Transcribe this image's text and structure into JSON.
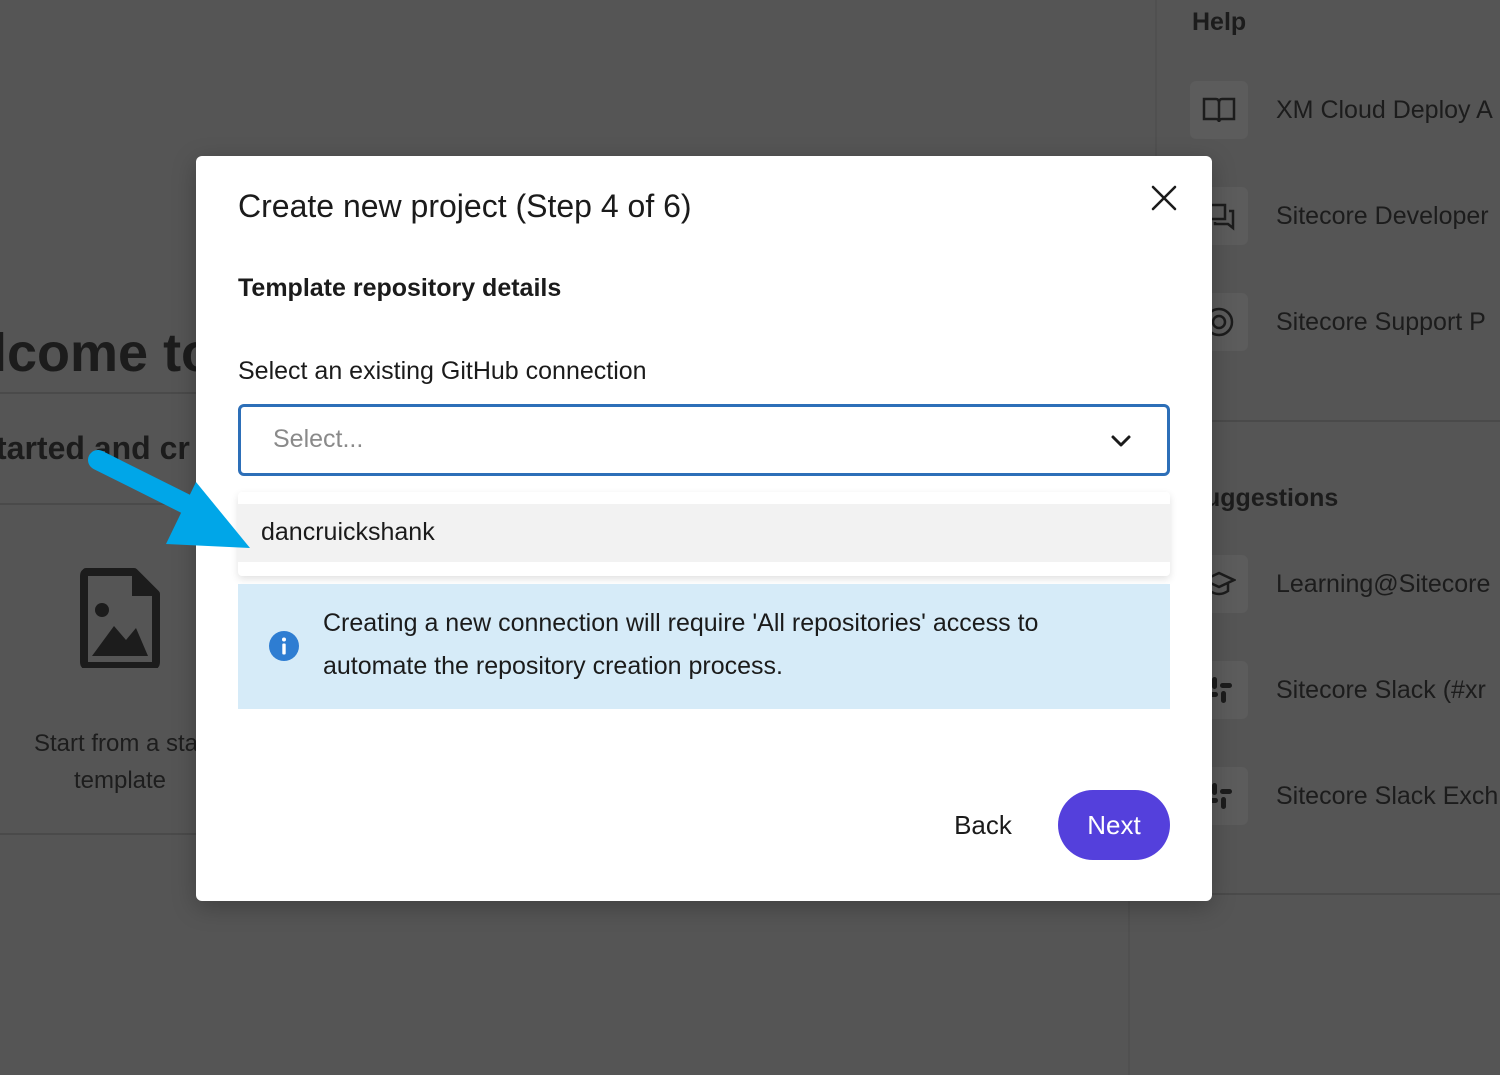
{
  "background": {
    "welcome_text": "lcome to",
    "started_text": "tarted and cr",
    "start_card": {
      "line1": "Start from a star",
      "line2": "template",
      "icon": "image-file-icon"
    },
    "sidebar": {
      "help_heading": "Help",
      "help_items": [
        {
          "label": "XM Cloud Deploy A",
          "icon": "book-icon"
        },
        {
          "label": "Sitecore Developer",
          "icon": "chat-icon"
        },
        {
          "label": "Sitecore Support P",
          "icon": "lifebuoy-icon"
        }
      ],
      "suggestions_heading": "uggestions",
      "suggestion_items": [
        {
          "label": "Learning@Sitecore",
          "icon": "graduation-cap-icon"
        },
        {
          "label": "Sitecore Slack (#xr",
          "icon": "slack-icon"
        },
        {
          "label": "Sitecore Slack Exch",
          "icon": "slack-icon"
        }
      ]
    }
  },
  "modal": {
    "title": "Create new project (Step 4 of 6)",
    "section_title": "Template repository details",
    "field_label": "Select an existing GitHub connection",
    "select": {
      "placeholder": "Select...",
      "options": [
        "dancruickshank"
      ]
    },
    "info": {
      "line1": "Creating a new connection will require 'All repositories' access to",
      "line2": "automate the repository creation process."
    },
    "back_label": "Back",
    "next_label": "Next"
  },
  "colors": {
    "accent": "#5440dc",
    "select_border": "#2d6fb8",
    "info_background": "#d6ebf8",
    "info_icon": "#2e7dd2",
    "annotation_arrow": "#00a6e8",
    "overlay": "#555555"
  }
}
